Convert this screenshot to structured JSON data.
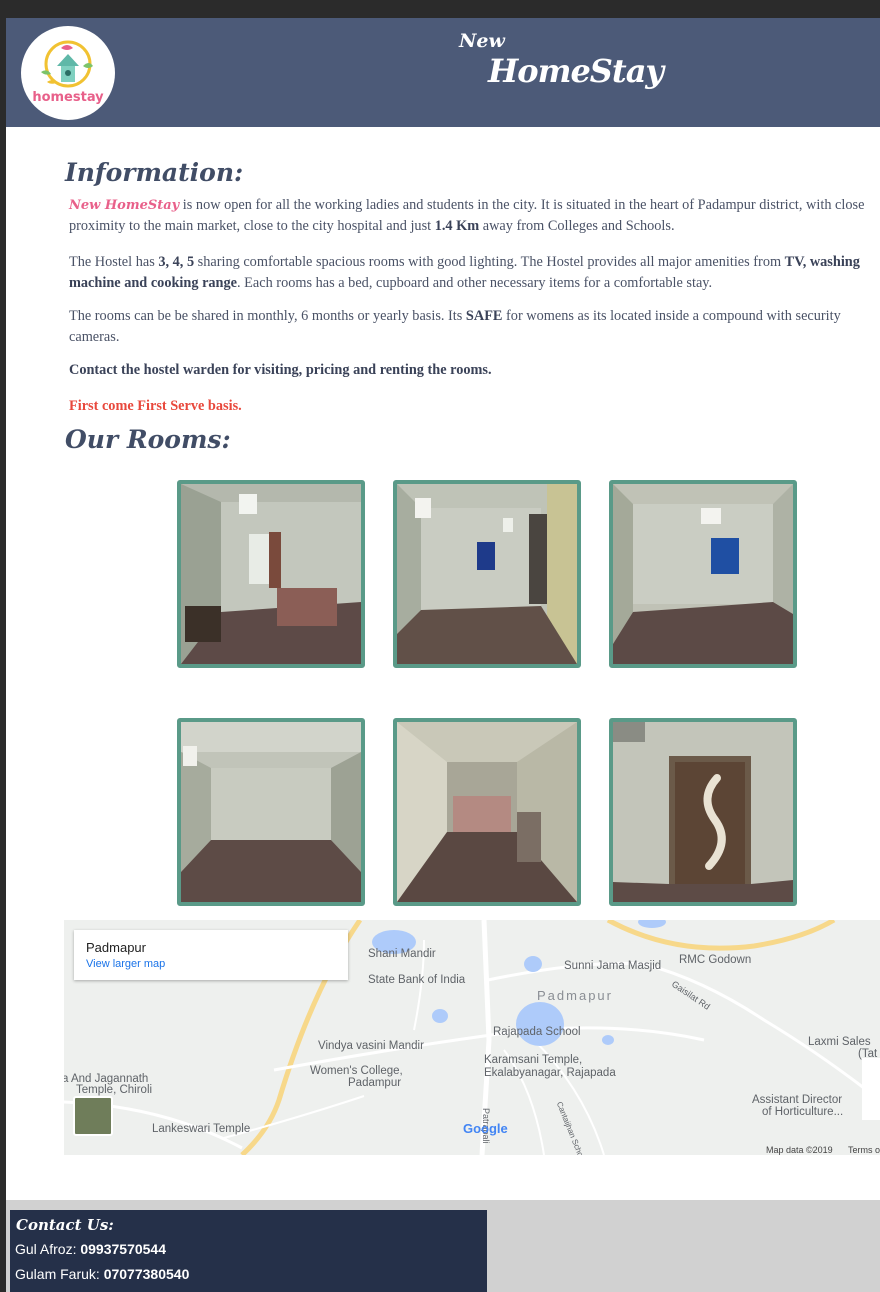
{
  "header": {
    "logo_text": "homestay",
    "brand_small": "New",
    "brand_big": "HomeStay"
  },
  "info": {
    "heading": "Information:",
    "brand_inline": "New HomeStay",
    "p1a": " is now open for all the working ladies and students in the city. It is situated in the heart of Padampur district, with close proximity to the main market, close to the city hospital and just ",
    "p1b": "1.4 Km",
    "p1c": " away from Colleges and Schools.",
    "p2a": "The Hostel has ",
    "p2b": "3, 4, 5",
    "p2c": " sharing comfortable spacious rooms with good lighting. The Hostel provides all major amenities from ",
    "p2d": "TV, washing machine and cooking range",
    "p2e": ". Each rooms has a bed, cupboard and other necessary items for a comfortable stay.",
    "p3a": "The rooms can be be shared in monthly, 6 months or yearly basis. Its ",
    "p3b": "SAFE",
    "p3c": " for womens as its located inside a compound with security cameras.",
    "p4": "Contact the hostel warden for visiting, pricing and renting the rooms.",
    "p5": "First come First Serve basis."
  },
  "rooms": {
    "heading": "Our Rooms:"
  },
  "map": {
    "place": "Padmapur",
    "link": "View larger map",
    "labels": [
      "Shani Mandir",
      "State Bank of India",
      "Sunni Jama Masjid",
      "RMC Godown",
      "Gaisilat Rd",
      "Padmapur",
      "Rajapada School",
      "Vindya vasini Mandir",
      "Karamsani Temple,",
      "Ekalabyanagar, Rajapada",
      "Women's College,",
      "Padampur",
      "a And Jagannath",
      "Temple, Chiroli",
      "Laxmi Sales",
      "(Tat",
      "Assistant Director",
      "of Horticulture...",
      "Lankeswari Temple",
      "Patrapali",
      "Cantaijhan School Rd",
      "Map data ©2019",
      "Terms o"
    ],
    "google": "Google"
  },
  "contact": {
    "heading": "Contact Us:",
    "name1": "Gul Afroz: ",
    "phone1": "09937570544",
    "name2": "Gulam Faruk: ",
    "phone2": "07077380540"
  }
}
